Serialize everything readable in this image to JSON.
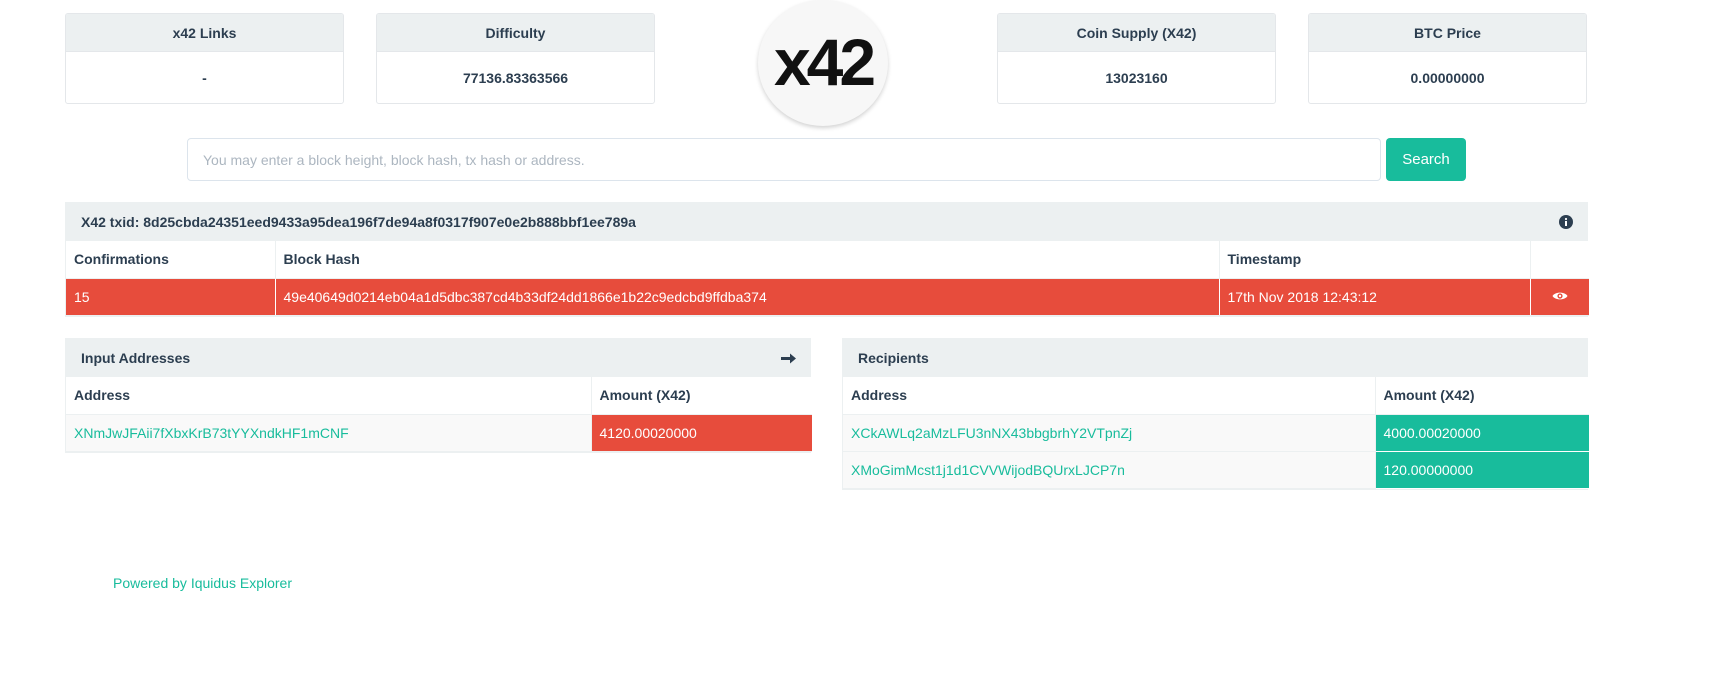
{
  "stats": [
    {
      "label": "x42 Links",
      "value": "-"
    },
    {
      "label": "Difficulty",
      "value": "77136.83363566"
    },
    {
      "label": "Coin Supply (X42)",
      "value": "13023160"
    },
    {
      "label": "BTC Price",
      "value": "0.00000000"
    }
  ],
  "logo": {
    "text": "x42"
  },
  "search": {
    "placeholder": "You may enter a block height, block hash, tx hash or address.",
    "value": "",
    "button_label": "Search"
  },
  "tx": {
    "title": "X42 txid: 8d25cbda24351eed9433a95dea196f7de94a8f0317f907e0e2b888bbf1ee789a",
    "info_icon": "info-circle-icon",
    "columns": [
      "Confirmations",
      "Block Hash",
      "Timestamp"
    ],
    "row": {
      "confirmations": "15",
      "block_hash": "49e40649d0214eb04a1d5dbc387cd4b33df24dd1866e1b22c9edcbd9ffdba374",
      "timestamp": "17th Nov 2018 12:43:12",
      "view_icon": "eye-icon"
    }
  },
  "inputs": {
    "title": "Input Addresses",
    "arrow_icon": "arrow-right-icon",
    "columns": [
      "Address",
      "Amount (X42)"
    ],
    "rows": [
      {
        "address": "XNmJwJFAii7fXbxKrB73tYYXndkHF1mCNF",
        "amount": "4120.00020000"
      }
    ]
  },
  "recipients": {
    "title": "Recipients",
    "columns": [
      "Address",
      "Amount (X42)"
    ],
    "rows": [
      {
        "address": "XCkAWLq2aMzLFU3nNX43bbgbrhY2VTpnZj",
        "amount": "4000.00020000"
      },
      {
        "address": "XMoGimMcst1j1d1CVVWijodBQUrxLJCP7n",
        "amount": "120.00000000"
      }
    ]
  },
  "footer": {
    "text": "Powered by Iquidus Explorer"
  },
  "colors": {
    "accent": "#18bc9c",
    "danger": "#e74c3c",
    "panel_head": "#ecf0f1",
    "text": "#2c3e50"
  }
}
